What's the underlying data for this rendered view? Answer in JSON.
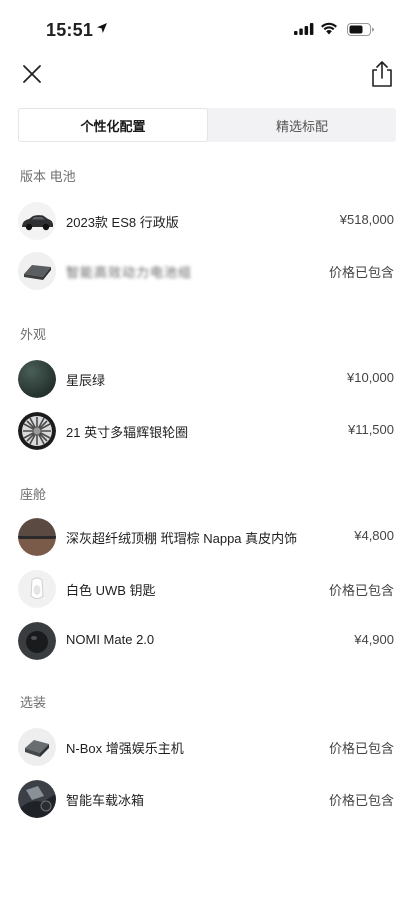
{
  "status_bar": {
    "time": "15:51"
  },
  "tabs": [
    {
      "label": "个性化配置",
      "active": true
    },
    {
      "label": "精选标配",
      "active": false
    }
  ],
  "sections": {
    "version": {
      "title": "版本 电池",
      "items": [
        {
          "label": "2023款 ES8 行政版",
          "price": "¥518,000",
          "icon": "car-thumbnail"
        },
        {
          "label": "智能高效动力电池组",
          "price": "价格已包含",
          "icon": "battery-pack-thumbnail"
        }
      ]
    },
    "exterior": {
      "title": "外观",
      "items": [
        {
          "label": "星辰绿",
          "price": "¥10,000",
          "icon": "paint-color-swatch"
        },
        {
          "label": "21 英寸多辐辉银轮圈",
          "price": "¥11,500",
          "icon": "wheel-thumbnail"
        }
      ]
    },
    "cabin": {
      "title": "座舱",
      "items": [
        {
          "label": "深灰超纤绒顶棚 玳瑁棕 Nappa 真皮内饰",
          "price": "¥4,800",
          "icon": "interior-swatch"
        },
        {
          "label": "白色 UWB 钥匙",
          "price": "价格已包含",
          "icon": "key-fob-thumbnail"
        },
        {
          "label": "NOMI Mate 2.0",
          "price": "¥4,900",
          "icon": "nomi-thumbnail"
        }
      ]
    },
    "options": {
      "title": "选装",
      "items": [
        {
          "label": "N-Box 增强娱乐主机",
          "price": "价格已包含",
          "icon": "nbox-thumbnail"
        },
        {
          "label": "智能车载冰箱",
          "price": "价格已包含",
          "icon": "fridge-thumbnail"
        }
      ]
    }
  },
  "colors": {
    "swatch_green": "#2b3a36",
    "tab_bg": "#f2f2f4",
    "accent_text": "#1f1f1f"
  }
}
